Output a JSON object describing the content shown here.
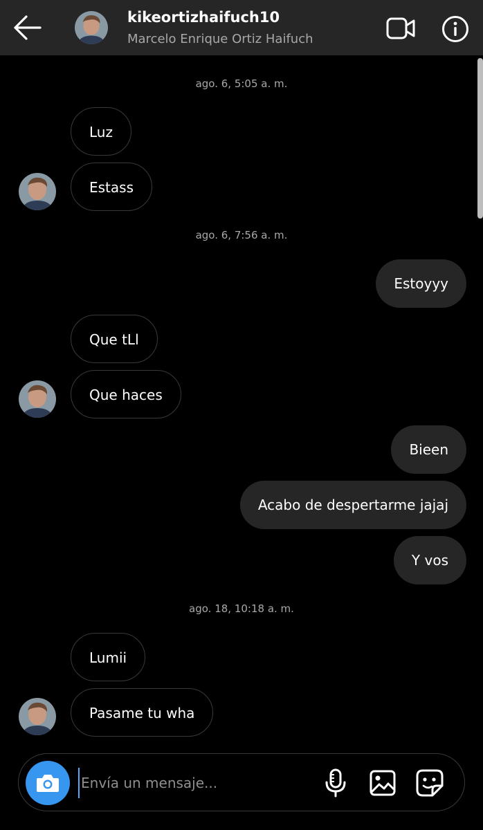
{
  "header": {
    "username": "kikeortizhaifuch10",
    "full_name": "Marcelo Enrique Ortiz Haifuch",
    "back_icon": "arrow-left-icon",
    "video_icon": "video-camera-icon",
    "info_icon": "info-icon"
  },
  "timestamps": [
    "ago. 6, 5:05 a. m.",
    "ago. 6, 7:56 a. m.",
    "ago. 18, 10:18 a. m."
  ],
  "messages": [
    {
      "sender": "them",
      "text": "Luz"
    },
    {
      "sender": "them",
      "text": "Estass"
    },
    {
      "sender": "me",
      "text": "Estoyyy"
    },
    {
      "sender": "them",
      "text": "Que tLl"
    },
    {
      "sender": "them",
      "text": "Que haces"
    },
    {
      "sender": "me",
      "text": "Bieen"
    },
    {
      "sender": "me",
      "text": "Acabo de despertarme jajaj"
    },
    {
      "sender": "me",
      "text": "Y vos"
    },
    {
      "sender": "them",
      "text": "Lumii"
    },
    {
      "sender": "them",
      "text": "Pasame tu wha"
    }
  ],
  "composer": {
    "placeholder": "Envía un mensaje...",
    "value": "",
    "icons": [
      "camera-icon",
      "microphone-icon",
      "gallery-icon",
      "sticker-icon"
    ]
  },
  "colors": {
    "background": "#000000",
    "header": "#262626",
    "outgoing_bubble": "#262626",
    "incoming_border": "#3a3a3a",
    "accent": "#3797f0",
    "secondary_text": "#a8a8a8"
  }
}
